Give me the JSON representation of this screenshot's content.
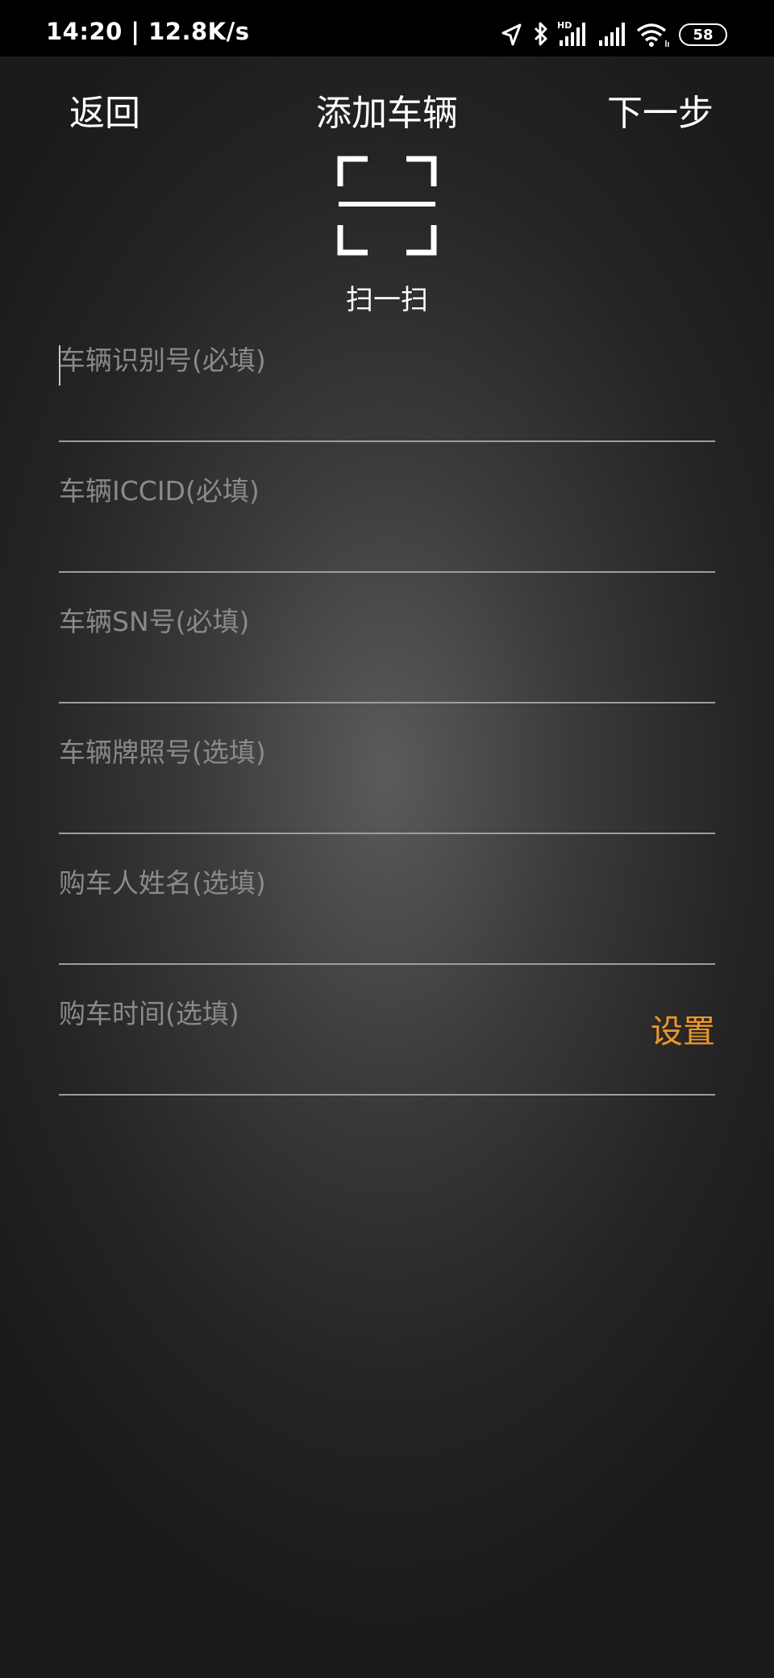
{
  "status_bar": {
    "time_speed": "14:20 | 12.8K/s",
    "battery_level": "58"
  },
  "header": {
    "back_label": "返回",
    "title": "添加车辆",
    "next_label": "下一步"
  },
  "scan": {
    "label": "扫一扫"
  },
  "fields": {
    "vin": {
      "placeholder": "车辆识别号(必填)",
      "value": ""
    },
    "iccid": {
      "placeholder": "车辆ICCID(必填)",
      "value": ""
    },
    "sn": {
      "placeholder": "车辆SN号(必填)",
      "value": ""
    },
    "plate": {
      "placeholder": "车辆牌照号(选填)",
      "value": ""
    },
    "buyer_name": {
      "placeholder": "购车人姓名(选填)",
      "value": ""
    },
    "purchase_time": {
      "placeholder": "购车时间(选填)",
      "value": "",
      "action_label": "设置"
    }
  },
  "colors": {
    "accent": "#f0972a",
    "placeholder": "#8a8a8a",
    "divider": "#9e9e9e"
  }
}
